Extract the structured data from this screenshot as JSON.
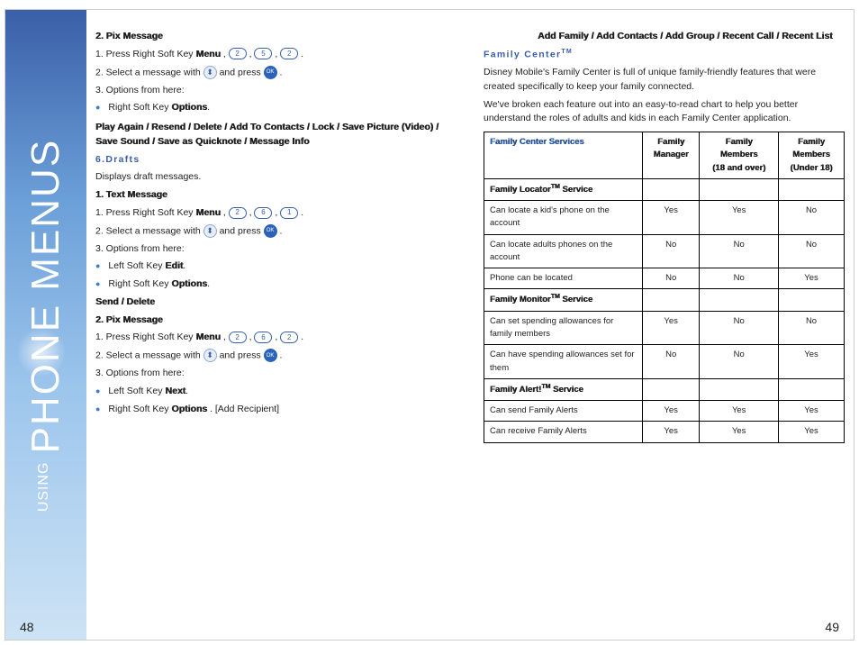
{
  "spine": {
    "small": "USING",
    "big": "PHONE MENUS"
  },
  "pages": {
    "left": "48",
    "right": "49"
  },
  "left": {
    "pixMsg": {
      "title": "2. Pix Message",
      "step1a": "1. Press Right Soft Key ",
      "step1b": "Menu",
      "step1c": ", ",
      "step2a": "2. Select a message with ",
      "step2b": " and press ",
      "step3": "3. Options from here:",
      "opt1a": "Right Soft Key ",
      "opt1b": "Options",
      "submenu": "Play Again / Resend / Delete / Add To Contacts / Lock / Save Picture (Video) / Save Sound / Save as Quicknote / Message Info"
    },
    "drafts": {
      "title": "6.Drafts",
      "desc": "Displays draft messages.",
      "txtTitle": "1. Text Message",
      "t_step1a": "1. Press Right Soft Key ",
      "t_step1b": "Menu",
      "t_step3": "3. Options from here:",
      "t_opt1a": "Left Soft Key ",
      "t_opt1b": "Edit",
      "t_opt2a": "Right Soft Key ",
      "t_opt2b": "Options",
      "t_sub": "Send / Delete",
      "pixTitle": "2. Pix Message",
      "p_step1a": "1. Press Right Soft Key ",
      "p_step1b": "Menu",
      "p_step3": "3. Options from here:",
      "p_opt1a": "Left Soft Key ",
      "p_opt1b": "Next",
      "p_opt2a": "Right Soft Key ",
      "p_opt2b": "Options",
      "p_opt2c": ". [Add Recipient]"
    },
    "keys": {
      "two": "2",
      "five": "5",
      "six": "6",
      "one": "1",
      "nav": "⬍",
      "ok": "OK",
      "comma": ", ",
      "dot": "."
    }
  },
  "right": {
    "addFamily": "Add Family / Add Contacts / Add Group / Recent Call / Recent List",
    "fcTitle": "Family Center",
    "tm": "TM",
    "p1": "Disney Mobile's Family Center is full of unique family-friendly features that were created specifically to keep your family connected.",
    "p2": "We've broken each feature out into an easy-to-read chart to help you better understand the roles of adults and kids in each Family Center application.",
    "table": {
      "h0": "Family Center Services",
      "h1a": "Family",
      "h1b": "Manager",
      "h2a": "Family",
      "h2b": "Members",
      "h2c": "(18 and over)",
      "h3a": "Family",
      "h3b": "Members",
      "h3c": "(Under 18)",
      "svc1": "Family Locator",
      "svc1s": "  Service",
      "svc2": "Family Monitor",
      "svc2s": " Service",
      "svc3": "Family Alert!",
      "svc3s": " Service",
      "rows": [
        {
          "label": "Can locate a kid's phone on the account",
          "c": [
            "Yes",
            "Yes",
            "No"
          ]
        },
        {
          "label": "Can locate adults phones on the account",
          "c": [
            "No",
            "No",
            "No"
          ]
        },
        {
          "label": "Phone can be located",
          "c": [
            "No",
            "No",
            "Yes"
          ]
        },
        {
          "label": "Can set spending allowances for family members",
          "c": [
            "Yes",
            "No",
            "No"
          ]
        },
        {
          "label": "Can have spending allowances set for them",
          "c": [
            "No",
            "No",
            "Yes"
          ]
        },
        {
          "label": "Can send Family Alerts",
          "c": [
            "Yes",
            "Yes",
            "Yes"
          ]
        },
        {
          "label": "Can receive Family Alerts",
          "c": [
            "Yes",
            "Yes",
            "Yes"
          ]
        }
      ]
    }
  }
}
